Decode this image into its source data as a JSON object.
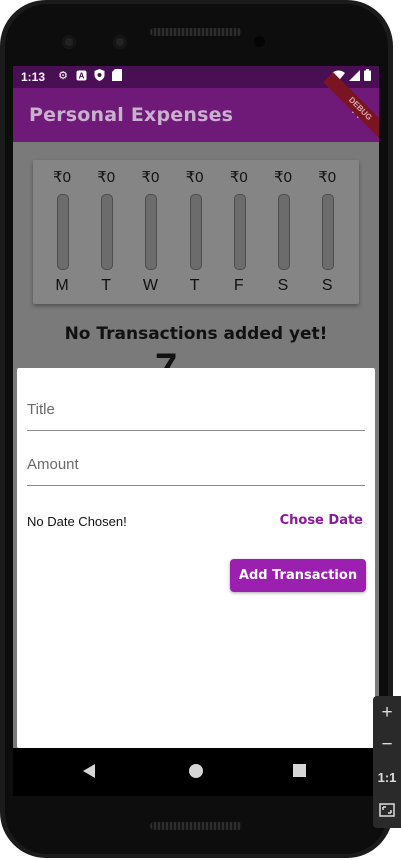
{
  "status_bar": {
    "time": "1:13",
    "left_icons": [
      "settings-icon",
      "font-icon",
      "shield-icon",
      "sd-card-icon"
    ],
    "right_icons": [
      "wifi-icon",
      "signal-icon",
      "battery-icon"
    ]
  },
  "app_bar": {
    "title": "Personal Expenses",
    "add_icon": "+",
    "debug_banner": "DEBUG"
  },
  "chart": {
    "days": [
      {
        "amount": "₹0",
        "label": "M",
        "fill": 0
      },
      {
        "amount": "₹0",
        "label": "T",
        "fill": 0
      },
      {
        "amount": "₹0",
        "label": "W",
        "fill": 0
      },
      {
        "amount": "₹0",
        "label": "T",
        "fill": 0
      },
      {
        "amount": "₹0",
        "label": "F",
        "fill": 0
      },
      {
        "amount": "₹0",
        "label": "S",
        "fill": 0
      },
      {
        "amount": "₹0",
        "label": "S",
        "fill": 0
      }
    ]
  },
  "empty_state": {
    "message": "No Transactions added yet!",
    "partial_glyph": "7"
  },
  "sheet": {
    "title_placeholder": "Title",
    "amount_placeholder": "Amount",
    "date_text": "No Date Chosen!",
    "chose_date_label": "Chose Date",
    "submit_label": "Add Transaction"
  },
  "emulator_tools": {
    "zoom_in": "+",
    "zoom_out": "−",
    "ratio": "1:1",
    "fit_icon": "fit-screen-icon"
  },
  "colors": {
    "primary": "#6f1978",
    "accent": "#9b20b0",
    "status_bar": "#4a0e55"
  }
}
